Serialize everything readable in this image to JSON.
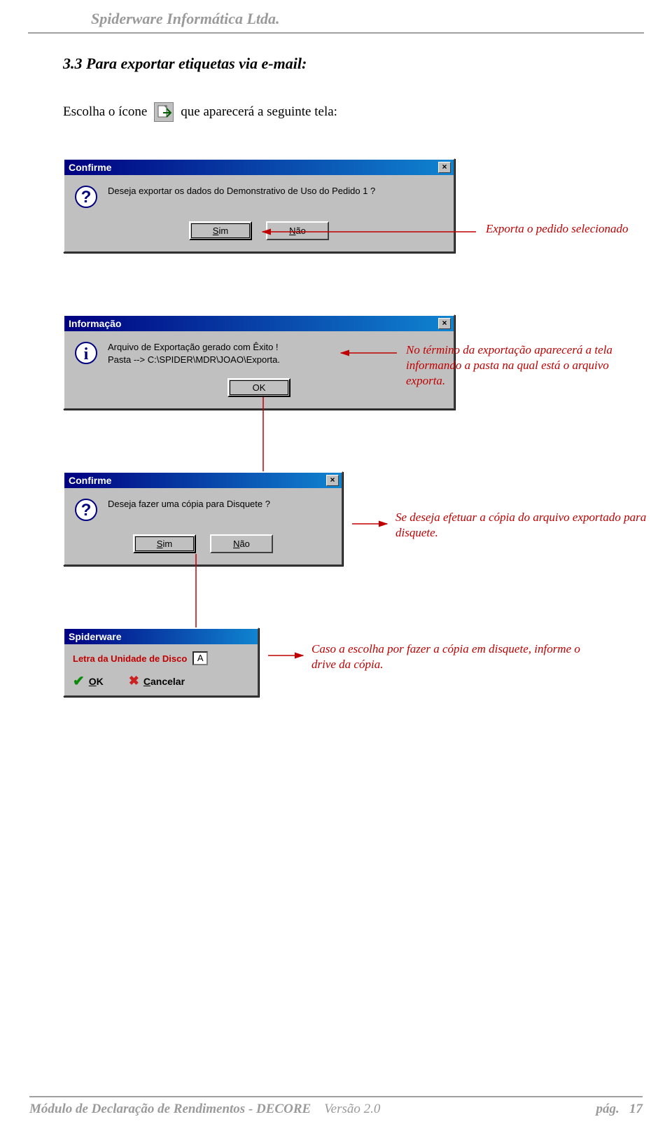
{
  "header": {
    "company": "Spiderware Informática Ltda."
  },
  "section": {
    "title": "3.3 Para exportar etiquetas via e-mail:"
  },
  "intro": {
    "pre": "Escolha o ícone",
    "post": "que aparecerá a seguinte tela:"
  },
  "dialog1": {
    "title": "Confirme",
    "message": "Deseja exportar os dados do Demonstrativo de Uso do Pedido 1 ?",
    "btn_yes": "Sim",
    "btn_no": "Não"
  },
  "callout1": "Exporta o pedido selecionado",
  "dialog2": {
    "title": "Informação",
    "line1": "Arquivo de Exportação gerado com Êxito !",
    "line2": "Pasta --> C:\\SPIDER\\MDR\\JOAO\\Exporta.",
    "btn_ok": "OK"
  },
  "callout2": "No término da exportação aparecerá a tela informando a pasta na qual está o arquivo exporta.",
  "dialog3": {
    "title": "Confirme",
    "message": "Deseja fazer uma cópia para Disquete ?",
    "btn_yes": "Sim",
    "btn_no": "Não"
  },
  "callout3": "Se deseja efetuar a cópia do arquivo exportado para disquete.",
  "dialog4": {
    "title": "Spiderware",
    "label": "Letra da Unidade de Disco",
    "value": "A",
    "ok": "OK",
    "cancel": "Cancelar"
  },
  "callout4": "Caso a escolha por fazer a cópia em disquete, informe o drive da cópia.",
  "footer": {
    "left": "Módulo de Declaração de Rendimentos - DECORE",
    "version": "Versão 2.0",
    "page_label": "pág.",
    "page_num": "17"
  }
}
